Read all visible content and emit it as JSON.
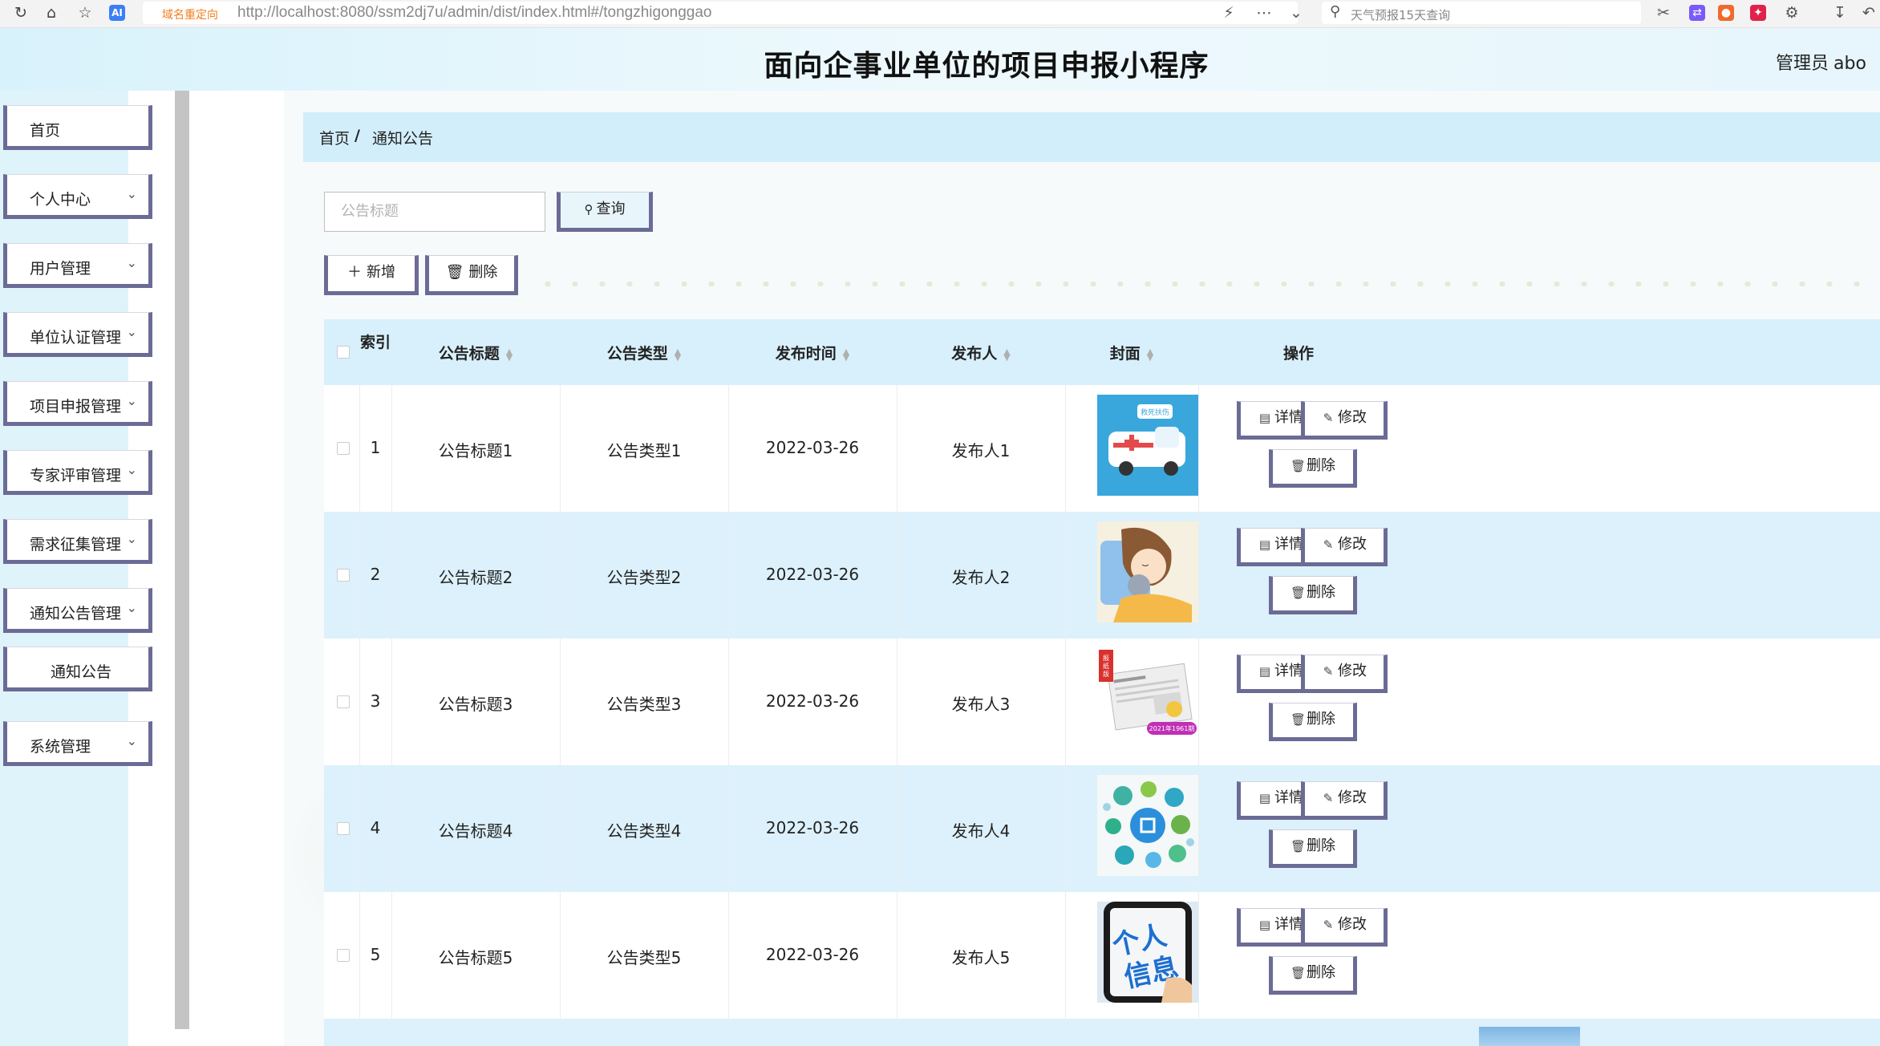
{
  "browser": {
    "redirect_label": "域名重定向",
    "url_host": "http://localhost",
    "url_rest": ":8080/ssm2dj7u/admin/dist/index.html#/tongzhigonggao",
    "search_placeholder": "天气预报15天查询",
    "ai_badge": "AI"
  },
  "header": {
    "title": "面向企事业单位的项目申报小程序",
    "user_role": "管理员",
    "user_name": "abo"
  },
  "sidebar": {
    "items": [
      {
        "label": "首页"
      },
      {
        "label": "个人中心"
      },
      {
        "label": "用户管理"
      },
      {
        "label": "单位认证管理"
      },
      {
        "label": "项目申报管理"
      },
      {
        "label": "专家评审管理"
      },
      {
        "label": "需求征集管理"
      },
      {
        "label": "通知公告管理"
      },
      {
        "label": "通知公告"
      },
      {
        "label": "系统管理"
      }
    ]
  },
  "breadcrumb": {
    "home": "首页",
    "sep": "/",
    "current": "通知公告"
  },
  "search": {
    "placeholder": "公告标题",
    "button": "查询"
  },
  "toolbar": {
    "add": "新增",
    "delete": "删除"
  },
  "table": {
    "headers": {
      "index": "索引",
      "title": "公告标题",
      "type": "公告类型",
      "time": "发布时间",
      "publisher": "发布人",
      "cover": "封面",
      "actions": "操作"
    },
    "rows": [
      {
        "index": "1",
        "title": "公告标题1",
        "type": "公告类型1",
        "time": "2022-03-26",
        "publisher": "发布人1",
        "cover": "ambulance"
      },
      {
        "index": "2",
        "title": "公告标题2",
        "type": "公告类型2",
        "time": "2022-03-26",
        "publisher": "发布人2",
        "cover": "sleeping-girl"
      },
      {
        "index": "3",
        "title": "公告标题3",
        "type": "公告类型3",
        "time": "2022-03-26",
        "publisher": "发布人3",
        "cover": "newspaper"
      },
      {
        "index": "4",
        "title": "公告标题4",
        "type": "公告类型4",
        "time": "2022-03-26",
        "publisher": "发布人4",
        "cover": "network-bubbles"
      },
      {
        "index": "5",
        "title": "公告标题5",
        "type": "公告类型5",
        "time": "2022-03-26",
        "publisher": "发布人5",
        "cover": "personal-info"
      }
    ],
    "row_actions": {
      "detail": "详情",
      "edit": "修改",
      "delete": "删除"
    }
  },
  "cover_text": {
    "ambulance": "救死扶伤",
    "newspaper_badge": "报纸版",
    "newspaper_issue": "2021年1961期",
    "personal_info": "个人信息"
  },
  "colors": {
    "header_bg": "#d8f2fb",
    "breadcrumb_bg": "#d3eefb",
    "table_header_bg": "#d8f0fb",
    "row_alt_bg": "#dcf1fb",
    "button_border": "#6b6b96"
  }
}
